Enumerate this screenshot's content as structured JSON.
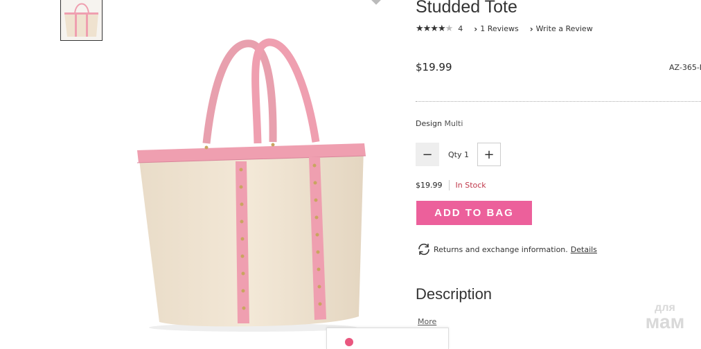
{
  "product": {
    "title": "Studded Tote",
    "rating_value": "4",
    "reviews_link": "1 Reviews",
    "write_review_link": "Write a Review",
    "price": "$19.99",
    "sku": "AZ-365-I",
    "design_label": "Design",
    "design_value": "Multi",
    "qty_label": "Qty",
    "qty_value": "1",
    "unit_price": "$19.99",
    "stock_status": "In Stock",
    "add_to_bag": "ADD TO BAG",
    "returns_text": "Returns and exchange information.",
    "returns_link": "Details",
    "description_heading": "Description",
    "more_link": "More",
    "stars_filled": 4,
    "stars_total": 5
  },
  "watermark": {
    "line1": "для",
    "line2": "мам"
  },
  "colors": {
    "accent": "#ec609b",
    "in_stock": "#c0384b",
    "bag_pink": "#ef9fb0",
    "bag_canvas": "#efe2cf"
  },
  "icons": {
    "returns": "refresh-icon",
    "minus": "minus-icon",
    "plus": "plus-icon",
    "chevron": "chevron-right-icon"
  }
}
